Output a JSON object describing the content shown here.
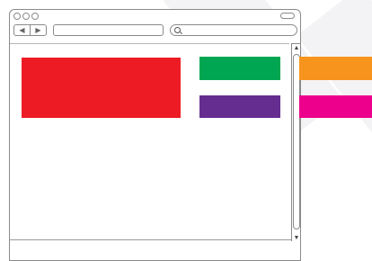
{
  "window": {
    "nav_back_icon": "back-arrow-icon",
    "nav_forward_icon": "forward-arrow-icon",
    "search_icon": "search-icon",
    "nav_back_glyph": "◀",
    "nav_forward_glyph": "▶",
    "scroll_up_glyph": "▲",
    "scroll_down_glyph": "▼"
  },
  "blocks": [
    {
      "id": "red-block",
      "color": "#ed1c24"
    },
    {
      "id": "green-block",
      "color": "#00a651"
    },
    {
      "id": "orange-block",
      "color": "#f7941d"
    },
    {
      "id": "purple-block",
      "color": "#662d91"
    },
    {
      "id": "magenta-block",
      "color": "#ec008c"
    }
  ]
}
